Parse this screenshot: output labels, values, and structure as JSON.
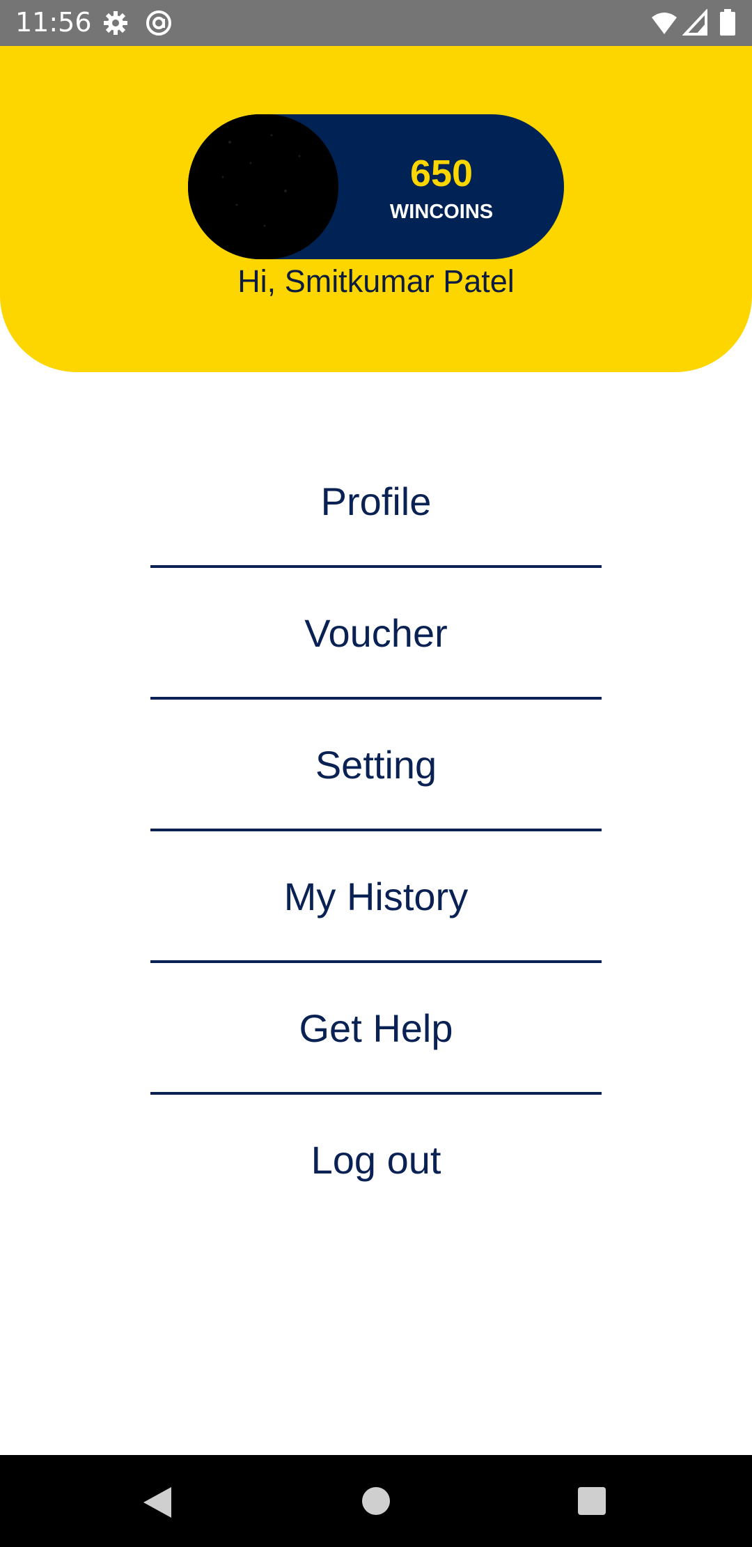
{
  "status_bar": {
    "time": "11:56",
    "icons": [
      "gear-icon",
      "at-sign-icon",
      "wifi-icon",
      "signal-icon",
      "battery-icon"
    ]
  },
  "header": {
    "background_color": "#FDD600",
    "coins": {
      "value": "650",
      "label": "WINCOINS",
      "pill_color": "#002254",
      "value_color": "#FDD600"
    },
    "greeting": "Hi, Smitkumar Patel"
  },
  "menu": {
    "items": [
      {
        "label": "Profile"
      },
      {
        "label": "Voucher"
      },
      {
        "label": "Setting"
      },
      {
        "label": "My History"
      },
      {
        "label": "Get Help"
      },
      {
        "label": "Log out"
      }
    ],
    "text_color": "#0a2154"
  },
  "nav_bar": {
    "buttons": [
      "back-icon",
      "home-icon",
      "recents-icon"
    ]
  }
}
